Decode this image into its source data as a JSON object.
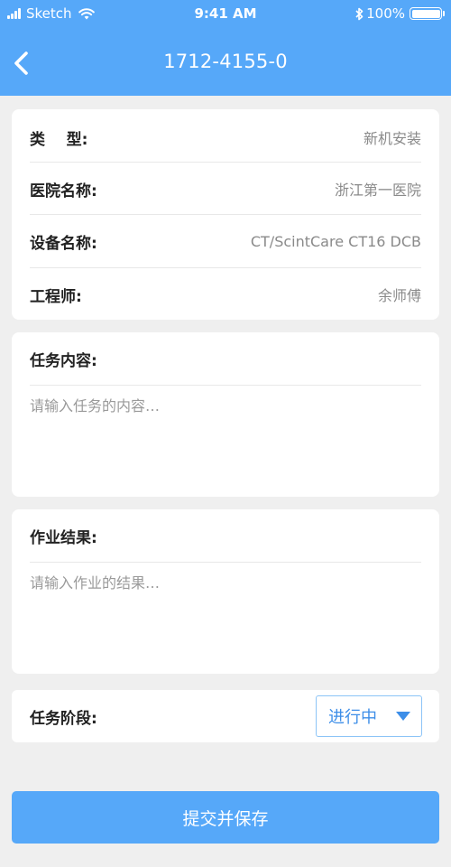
{
  "status_bar": {
    "carrier": "Sketch",
    "time": "9:41 AM",
    "battery": "100%"
  },
  "nav": {
    "title": "1712-4155-0",
    "back_icon": "chevron-left-icon"
  },
  "info": {
    "type_label": "类    型:",
    "type_value": "新机安装",
    "hospital_label": "医院名称:",
    "hospital_value": "浙江第一医院",
    "device_label": "设备名称:",
    "device_value": "CT/ScintCare CT16 DCB",
    "engineer_label": "工程师:",
    "engineer_value": "余师傅"
  },
  "task": {
    "label": "任务内容:",
    "placeholder": "请输入任务的内容…",
    "value": ""
  },
  "result": {
    "label": "作业结果:",
    "placeholder": "请输入作业的结果…",
    "value": ""
  },
  "stage": {
    "label": "任务阶段:",
    "selected": "进行中"
  },
  "submit_label": "提交并保存",
  "colors": {
    "accent": "#56a8f9",
    "select_text": "#3d8ee8",
    "background": "#efefef"
  }
}
